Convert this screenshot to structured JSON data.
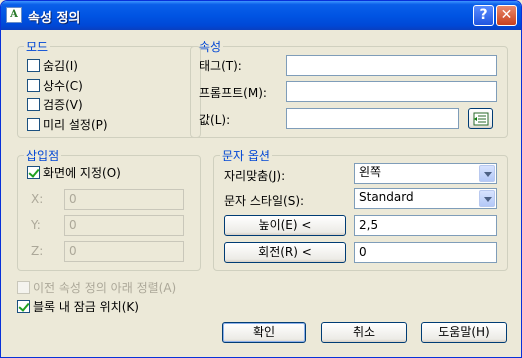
{
  "window": {
    "title": "속성 정의",
    "app_icon_glyph": "A"
  },
  "mode": {
    "legend": "모드",
    "items": [
      {
        "label": "숨김(I)",
        "checked": false
      },
      {
        "label": "상수(C)",
        "checked": false
      },
      {
        "label": "검증(V)",
        "checked": false
      },
      {
        "label": "미리 설정(P)",
        "checked": false
      }
    ]
  },
  "attribute": {
    "legend": "속성",
    "tag_label": "태그(T):",
    "tag_value": "",
    "prompt_label": "프롬프트(M):",
    "prompt_value": "",
    "value_label": "값(L):",
    "value_value": ""
  },
  "insertion": {
    "legend": "삽입점",
    "specify_label": "화면에 지정(O)",
    "specify_checked": true,
    "x_label": "X:",
    "x_value": "0",
    "y_label": "Y:",
    "y_value": "0",
    "z_label": "Z:",
    "z_value": "0"
  },
  "text_options": {
    "legend": "문자 옵션",
    "justify_label": "자리맞춤(J):",
    "justify_value": "왼쪽",
    "style_label": "문자 스타일(S):",
    "style_value": "Standard",
    "height_button": "높이(E) <",
    "height_value": "2,5",
    "rotation_button": "회전(R) <",
    "rotation_value": "0"
  },
  "align_below": {
    "label": "이전 속성 정의 아래 정렬(A)",
    "checked": false,
    "enabled": false
  },
  "lock_in_block": {
    "label": "블록 내 잠금 위치(K)",
    "checked": true
  },
  "buttons": {
    "ok": "확인",
    "cancel": "취소",
    "help": "도움말(H)"
  },
  "titlebar_buttons": {
    "help": "?",
    "close": "✕"
  }
}
